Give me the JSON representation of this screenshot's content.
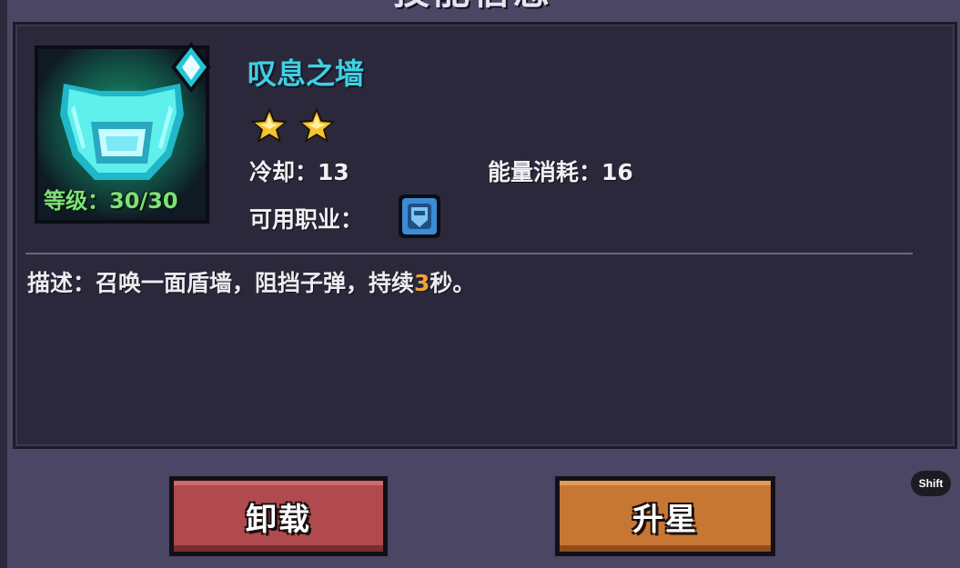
{
  "dialog": {
    "title": "技能信息"
  },
  "skill": {
    "name": "叹息之墙",
    "icon": "shield-wall-icon",
    "level_label": "等级：30/30",
    "stars": 2,
    "cooldown_label": "冷却：13",
    "energy_label": "能量消耗：16",
    "class_label": "可用职业：",
    "class_icon": "knight-helmet-icon",
    "gem_icon": "diamond-gem-icon",
    "description_prefix": "描述：召唤一面盾墙，阻挡子弹，持续",
    "description_highlight": "3",
    "description_suffix": "秒。"
  },
  "buttons": {
    "unequip_label": "卸载",
    "upgrade_label": "升星"
  },
  "shortcut": {
    "label": "Shift"
  },
  "colors": {
    "skill_name": "#3fd0e3",
    "level_text": "#7ee07a",
    "highlight": "#f0a23a",
    "unequip_button": "#b04a4e",
    "upgrade_button": "#c77634"
  }
}
